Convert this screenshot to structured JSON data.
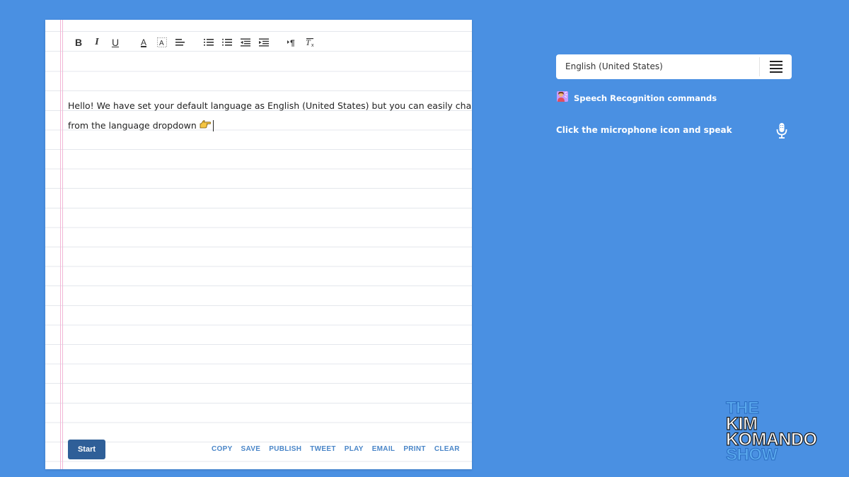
{
  "editor": {
    "toolbar": {
      "bold": "B",
      "italic": "I",
      "underline": "U",
      "font_color": "A"
    },
    "lines": [
      " Hello!  We have set your default language as  English (United States) but you can easily change it",
      "from the language dropdown"
    ],
    "pointer_icon": "backhand-index-pointing-right-icon",
    "start_label": "Start",
    "actions": [
      "COPY",
      "SAVE",
      "PUBLISH",
      "TWEET",
      "PLAY",
      "EMAIL",
      "PRINT",
      "CLEAR"
    ]
  },
  "panel": {
    "language_value": "English (United States)",
    "commands_label": "Speech Recognition commands",
    "mic_hint": "Click the microphone icon and speak"
  },
  "logo": {
    "the": "THE",
    "kim": "KIM",
    "komando": "KOMANDO",
    "show": "SHOW"
  },
  "colors": {
    "background": "#4a90e2",
    "start_button": "#2f5f98",
    "action_link": "#4a86c8",
    "margin_line": "#f2b6d6"
  }
}
